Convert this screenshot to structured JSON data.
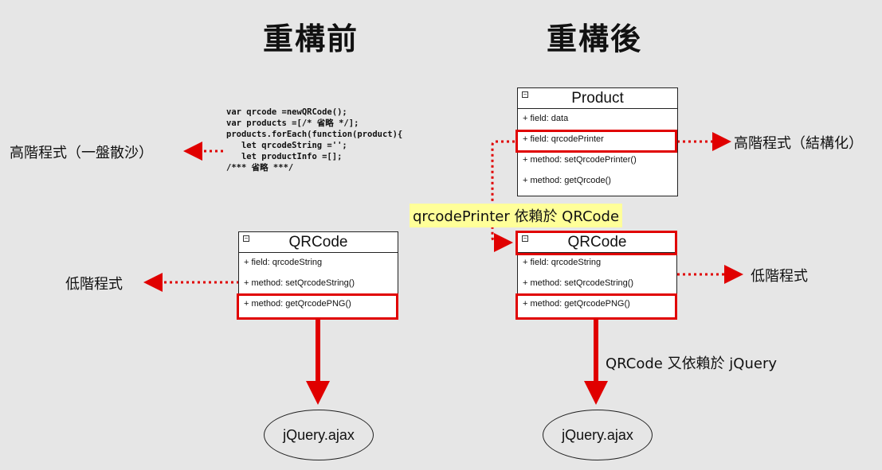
{
  "before": {
    "title": "重構前",
    "code_lines": [
      "var qrcode =newQRCode();",
      "var products =[/* 省略 */];",
      "products.forEach(function(product){",
      "   let qrcodeString ='';",
      "   let productInfo =[];",
      "",
      "/*** 省略 ***/"
    ],
    "high_label": "高階程式（一盤散沙）",
    "low_label": "低階程式",
    "qrcode_box": {
      "name": "QRCode",
      "rows": [
        "+ field: qrcodeString",
        "+ method: setQrcodeString()",
        "+ method: getQrcodePNG()"
      ]
    },
    "ellipse": "jQuery.ajax"
  },
  "after": {
    "title": "重構後",
    "product_box": {
      "name": "Product",
      "rows": [
        "+ field: data",
        "+ field: qrcodePrinter",
        "+ method: setQrcodePrinter()",
        "+ method: getQrcode()"
      ]
    },
    "high_label": "高階程式（結構化）",
    "dependency_note": "qrcodePrinter 依賴於 QRCode",
    "qrcode_box": {
      "name": "QRCode",
      "rows": [
        "+ field: qrcodeString",
        "+ method: setQrcodeString()",
        "+ method: getQrcodePNG()"
      ]
    },
    "low_label": "低階程式",
    "jquery_note": "QRCode 又依賴於 jQuery",
    "ellipse": "jQuery.ajax"
  },
  "colors": {
    "highlight": "#e00000",
    "note_bg": "#ffff99",
    "background": "#e6e6e6"
  }
}
